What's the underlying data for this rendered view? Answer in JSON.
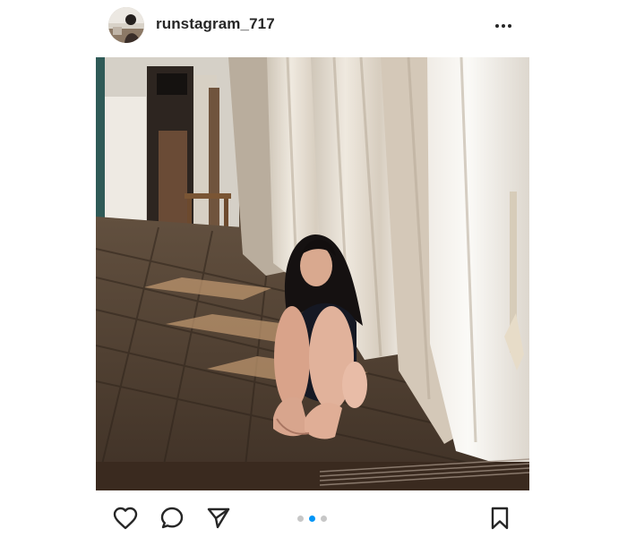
{
  "post": {
    "username": "runstagram_717",
    "photo_caption": ""
  },
  "icons": {
    "more": "more-horizontal-icon",
    "like": "heart-icon",
    "comment": "comment-icon",
    "share": "send-icon",
    "save": "bookmark-icon"
  },
  "carousel": {
    "total": 3,
    "active_index": 1
  },
  "colors": {
    "text": "#262626",
    "dot_active": "#0095f6",
    "dot_inactive": "#c7c7c7"
  }
}
